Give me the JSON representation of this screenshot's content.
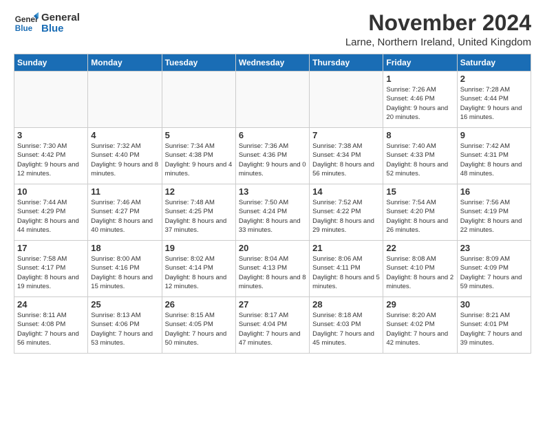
{
  "logo": {
    "line1": "General",
    "line2": "Blue"
  },
  "title": "November 2024",
  "location": "Larne, Northern Ireland, United Kingdom",
  "days_of_week": [
    "Sunday",
    "Monday",
    "Tuesday",
    "Wednesday",
    "Thursday",
    "Friday",
    "Saturday"
  ],
  "weeks": [
    [
      {
        "day": "",
        "info": ""
      },
      {
        "day": "",
        "info": ""
      },
      {
        "day": "",
        "info": ""
      },
      {
        "day": "",
        "info": ""
      },
      {
        "day": "",
        "info": ""
      },
      {
        "day": "1",
        "info": "Sunrise: 7:26 AM\nSunset: 4:46 PM\nDaylight: 9 hours and 20 minutes."
      },
      {
        "day": "2",
        "info": "Sunrise: 7:28 AM\nSunset: 4:44 PM\nDaylight: 9 hours and 16 minutes."
      }
    ],
    [
      {
        "day": "3",
        "info": "Sunrise: 7:30 AM\nSunset: 4:42 PM\nDaylight: 9 hours and 12 minutes."
      },
      {
        "day": "4",
        "info": "Sunrise: 7:32 AM\nSunset: 4:40 PM\nDaylight: 9 hours and 8 minutes."
      },
      {
        "day": "5",
        "info": "Sunrise: 7:34 AM\nSunset: 4:38 PM\nDaylight: 9 hours and 4 minutes."
      },
      {
        "day": "6",
        "info": "Sunrise: 7:36 AM\nSunset: 4:36 PM\nDaylight: 9 hours and 0 minutes."
      },
      {
        "day": "7",
        "info": "Sunrise: 7:38 AM\nSunset: 4:34 PM\nDaylight: 8 hours and 56 minutes."
      },
      {
        "day": "8",
        "info": "Sunrise: 7:40 AM\nSunset: 4:33 PM\nDaylight: 8 hours and 52 minutes."
      },
      {
        "day": "9",
        "info": "Sunrise: 7:42 AM\nSunset: 4:31 PM\nDaylight: 8 hours and 48 minutes."
      }
    ],
    [
      {
        "day": "10",
        "info": "Sunrise: 7:44 AM\nSunset: 4:29 PM\nDaylight: 8 hours and 44 minutes."
      },
      {
        "day": "11",
        "info": "Sunrise: 7:46 AM\nSunset: 4:27 PM\nDaylight: 8 hours and 40 minutes."
      },
      {
        "day": "12",
        "info": "Sunrise: 7:48 AM\nSunset: 4:25 PM\nDaylight: 8 hours and 37 minutes."
      },
      {
        "day": "13",
        "info": "Sunrise: 7:50 AM\nSunset: 4:24 PM\nDaylight: 8 hours and 33 minutes."
      },
      {
        "day": "14",
        "info": "Sunrise: 7:52 AM\nSunset: 4:22 PM\nDaylight: 8 hours and 29 minutes."
      },
      {
        "day": "15",
        "info": "Sunrise: 7:54 AM\nSunset: 4:20 PM\nDaylight: 8 hours and 26 minutes."
      },
      {
        "day": "16",
        "info": "Sunrise: 7:56 AM\nSunset: 4:19 PM\nDaylight: 8 hours and 22 minutes."
      }
    ],
    [
      {
        "day": "17",
        "info": "Sunrise: 7:58 AM\nSunset: 4:17 PM\nDaylight: 8 hours and 19 minutes."
      },
      {
        "day": "18",
        "info": "Sunrise: 8:00 AM\nSunset: 4:16 PM\nDaylight: 8 hours and 15 minutes."
      },
      {
        "day": "19",
        "info": "Sunrise: 8:02 AM\nSunset: 4:14 PM\nDaylight: 8 hours and 12 minutes."
      },
      {
        "day": "20",
        "info": "Sunrise: 8:04 AM\nSunset: 4:13 PM\nDaylight: 8 hours and 8 minutes."
      },
      {
        "day": "21",
        "info": "Sunrise: 8:06 AM\nSunset: 4:11 PM\nDaylight: 8 hours and 5 minutes."
      },
      {
        "day": "22",
        "info": "Sunrise: 8:08 AM\nSunset: 4:10 PM\nDaylight: 8 hours and 2 minutes."
      },
      {
        "day": "23",
        "info": "Sunrise: 8:09 AM\nSunset: 4:09 PM\nDaylight: 7 hours and 59 minutes."
      }
    ],
    [
      {
        "day": "24",
        "info": "Sunrise: 8:11 AM\nSunset: 4:08 PM\nDaylight: 7 hours and 56 minutes."
      },
      {
        "day": "25",
        "info": "Sunrise: 8:13 AM\nSunset: 4:06 PM\nDaylight: 7 hours and 53 minutes."
      },
      {
        "day": "26",
        "info": "Sunrise: 8:15 AM\nSunset: 4:05 PM\nDaylight: 7 hours and 50 minutes."
      },
      {
        "day": "27",
        "info": "Sunrise: 8:17 AM\nSunset: 4:04 PM\nDaylight: 7 hours and 47 minutes."
      },
      {
        "day": "28",
        "info": "Sunrise: 8:18 AM\nSunset: 4:03 PM\nDaylight: 7 hours and 45 minutes."
      },
      {
        "day": "29",
        "info": "Sunrise: 8:20 AM\nSunset: 4:02 PM\nDaylight: 7 hours and 42 minutes."
      },
      {
        "day": "30",
        "info": "Sunrise: 8:21 AM\nSunset: 4:01 PM\nDaylight: 7 hours and 39 minutes."
      }
    ]
  ]
}
